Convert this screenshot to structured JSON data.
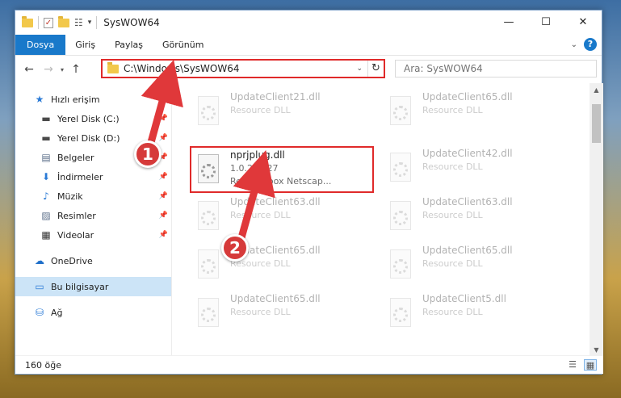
{
  "window": {
    "title": "SysWOW64"
  },
  "controls": {
    "minimize": "—",
    "maximize": "☐",
    "close": "✕"
  },
  "ribbon": {
    "tabs": [
      "Dosya",
      "Giriş",
      "Paylaş",
      "Görünüm"
    ]
  },
  "address": {
    "path": "C:\\Windows\\SysWOW64"
  },
  "search": {
    "placeholder": "Ara: SysWOW64"
  },
  "sidebar": {
    "quick_access": "Hızlı erişim",
    "items": [
      {
        "label": "Yerel Disk (C:)",
        "icon": "drive-icon",
        "pinned": true
      },
      {
        "label": "Yerel Disk (D:)",
        "icon": "drive-icon",
        "pinned": true
      },
      {
        "label": "Belgeler",
        "icon": "documents-icon",
        "pinned": true
      },
      {
        "label": "İndirmeler",
        "icon": "download-icon",
        "pinned": true
      },
      {
        "label": "Müzik",
        "icon": "music-icon",
        "pinned": true
      },
      {
        "label": "Resimler",
        "icon": "pictures-icon",
        "pinned": true
      },
      {
        "label": "Videolar",
        "icon": "videos-icon",
        "pinned": true
      }
    ],
    "onedrive": "OneDrive",
    "this_pc": "Bu bilgisayar",
    "network": "Ağ"
  },
  "files": {
    "highlighted": {
      "name": "nprjplug.dll",
      "version": "1.0.2.1127",
      "description": "RealJukebox Netscap..."
    },
    "left": [
      {
        "name": "UpdateClient21.dll",
        "description": "Resource DLL"
      },
      {
        "name": "UpdateClient63.dll",
        "description": "Resource DLL"
      },
      {
        "name": "UpdateClient65.dll",
        "description": "Resource DLL"
      },
      {
        "name": "UpdateClient65.dll",
        "description": "Resource DLL"
      }
    ],
    "right": [
      {
        "name": "UpdateClient65.dll",
        "description": "Resource DLL"
      },
      {
        "name": "UpdateClient42.dll",
        "description": "Resource DLL"
      },
      {
        "name": "UpdateClient63.dll",
        "description": "Resource DLL"
      },
      {
        "name": "UpdateClient65.dll",
        "description": "Resource DLL"
      },
      {
        "name": "UpdateClient5.dll",
        "description": "Resource DLL"
      }
    ]
  },
  "status": {
    "count": "160 öğe"
  },
  "markers": {
    "one": "1",
    "two": "2"
  },
  "colors": {
    "accent": "#1979ca",
    "highlight": "#e02a2a"
  }
}
